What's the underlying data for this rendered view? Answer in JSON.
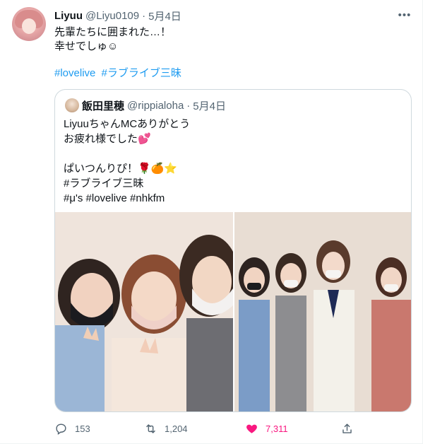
{
  "tweet": {
    "author_name": "Liyuu",
    "author_handle": "@Liyu0109",
    "separator": "·",
    "date": "5月4日",
    "more_label": "•••",
    "text_lines": [
      "先輩たちに囲まれた…！",
      "幸せでしゅ☺"
    ],
    "hashtags": [
      "#lovelive",
      "#ラブライブ三昧"
    ]
  },
  "quote": {
    "author_name": "飯田里穂",
    "author_handle": "@rippialoha",
    "separator": "·",
    "date": "5月4日",
    "line1": "LiyuuちゃんMCありがとう",
    "line2_text": "お疲れ様でした",
    "line2_emoji": "💕",
    "line3_text": "ぱいつんりぴ！",
    "line3_emoji1": "🌹",
    "line3_emoji2": "🍊",
    "line3_emoji3": "⭐",
    "line4": "#ラブライブ三昧",
    "line5": "#μ's #lovelive #nhkfm"
  },
  "actions": {
    "reply_count": "153",
    "retweet_count": "1,204",
    "like_count": "7,311",
    "icons": [
      "reply-icon",
      "retweet-icon",
      "heart-icon",
      "share-icon"
    ]
  },
  "colors": {
    "link": "#1d9bf0",
    "secondary_text": "#536471",
    "like": "#f91880",
    "border": "#cfd9de"
  }
}
